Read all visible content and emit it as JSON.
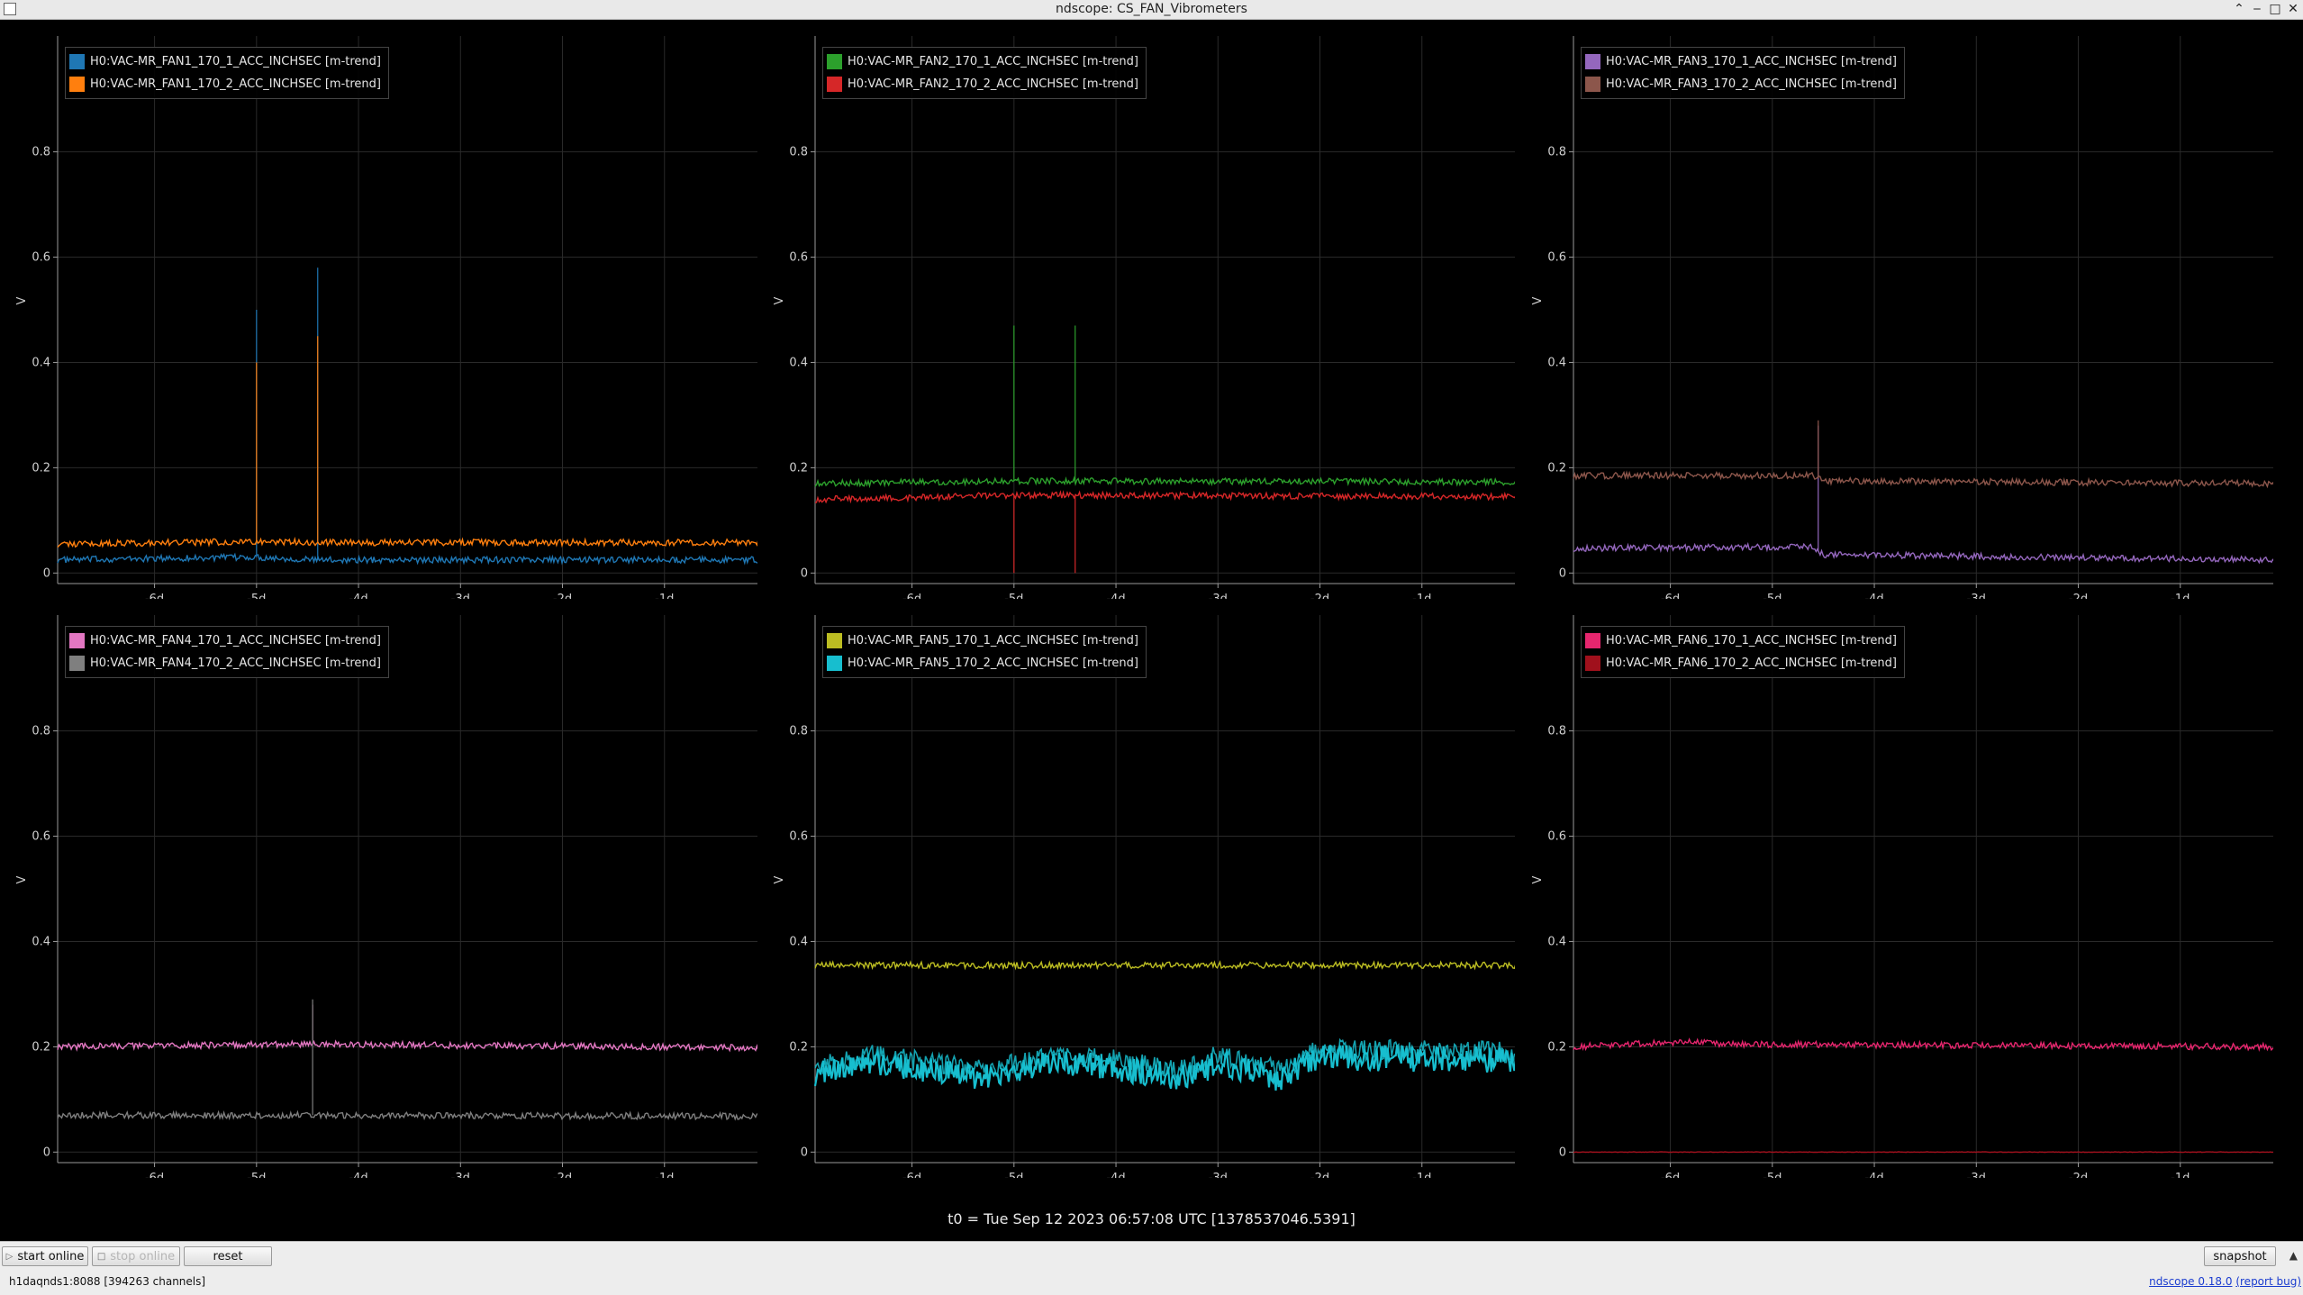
{
  "window": {
    "title": "ndscope: CS_FAN_Vibrometers",
    "controls": [
      "⌃",
      "‒",
      "□",
      "✕"
    ]
  },
  "plots": [
    {
      "legend": [
        {
          "label": "H0:VAC-MR_FAN1_170_1_ACC_INCHSEC [m-trend]",
          "color": "#1f77b4"
        },
        {
          "label": "H0:VAC-MR_FAN1_170_2_ACC_INCHSEC [m-trend]",
          "color": "#ff7f0e"
        }
      ]
    },
    {
      "legend": [
        {
          "label": "H0:VAC-MR_FAN2_170_1_ACC_INCHSEC [m-trend]",
          "color": "#2ca02c"
        },
        {
          "label": "H0:VAC-MR_FAN2_170_2_ACC_INCHSEC [m-trend]",
          "color": "#d62728"
        }
      ]
    },
    {
      "legend": [
        {
          "label": "H0:VAC-MR_FAN3_170_1_ACC_INCHSEC [m-trend]",
          "color": "#9467bd"
        },
        {
          "label": "H0:VAC-MR_FAN3_170_2_ACC_INCHSEC [m-trend]",
          "color": "#8c564b"
        }
      ]
    },
    {
      "legend": [
        {
          "label": "H0:VAC-MR_FAN4_170_1_ACC_INCHSEC [m-trend]",
          "color": "#e377c2"
        },
        {
          "label": "H0:VAC-MR_FAN4_170_2_ACC_INCHSEC [m-trend]",
          "color": "#7f7f7f"
        }
      ]
    },
    {
      "legend": [
        {
          "label": "H0:VAC-MR_FAN5_170_1_ACC_INCHSEC [m-trend]",
          "color": "#bcbd22"
        },
        {
          "label": "H0:VAC-MR_FAN5_170_2_ACC_INCHSEC [m-trend]",
          "color": "#17becf"
        }
      ]
    },
    {
      "legend": [
        {
          "label": "H0:VAC-MR_FAN6_170_1_ACC_INCHSEC [m-trend]",
          "color": "#e6266e"
        },
        {
          "label": "H0:VAC-MR_FAN6_170_2_ACC_INCHSEC [m-trend]",
          "color": "#a0101c"
        }
      ]
    }
  ],
  "axes": {
    "ylabel": "V",
    "xticks": [
      "-6d",
      "-5d",
      "-4d",
      "-3d",
      "-2d",
      "-1d"
    ],
    "yticks": [
      "0",
      "0.2",
      "0.4",
      "0.6",
      "0.8"
    ]
  },
  "chart_data": [
    {
      "type": "line",
      "x_unit": "days",
      "xlim": [
        -6.95,
        0
      ],
      "ylim": [
        0,
        1.0
      ],
      "ylabel": "V",
      "series": [
        {
          "name": "H0:VAC-MR_FAN1_170_1_ACC_INCHSEC [m-trend]",
          "color": "#1f77b4",
          "x": [
            -6.95,
            -5.0,
            -4.4,
            0
          ],
          "y": [
            0.025,
            0.03,
            0.025,
            0.025
          ],
          "spikes": [
            {
              "x": -5.0,
              "y": 0.5
            },
            {
              "x": -4.4,
              "y": 0.58
            }
          ]
        },
        {
          "name": "H0:VAC-MR_FAN1_170_2_ACC_INCHSEC [m-trend]",
          "color": "#ff7f0e",
          "x": [
            -6.95,
            -5.0,
            -4.4,
            0
          ],
          "y": [
            0.055,
            0.06,
            0.058,
            0.058
          ],
          "spikes": [
            {
              "x": -5.0,
              "y": 0.4
            },
            {
              "x": -4.4,
              "y": 0.45
            }
          ]
        }
      ]
    },
    {
      "type": "line",
      "x_unit": "days",
      "xlim": [
        -6.95,
        0
      ],
      "ylim": [
        0,
        1.0
      ],
      "ylabel": "V",
      "series": [
        {
          "name": "H0:VAC-MR_FAN2_170_1_ACC_INCHSEC [m-trend]",
          "color": "#2ca02c",
          "x": [
            -6.95,
            -5.0,
            0
          ],
          "y": [
            0.17,
            0.175,
            0.173
          ],
          "spikes": [
            {
              "x": -5.0,
              "y": 0.47
            },
            {
              "x": -4.4,
              "y": 0.47
            }
          ]
        },
        {
          "name": "H0:VAC-MR_FAN2_170_2_ACC_INCHSEC [m-trend]",
          "color": "#d62728",
          "x": [
            -6.95,
            -5.0,
            0
          ],
          "y": [
            0.14,
            0.148,
            0.145
          ],
          "spikes": [
            {
              "x": -5.0,
              "y": 0.0
            },
            {
              "x": -4.4,
              "y": 0.0
            }
          ]
        }
      ]
    },
    {
      "type": "line",
      "x_unit": "days",
      "xlim": [
        -6.95,
        0
      ],
      "ylim": [
        0,
        1.0
      ],
      "ylabel": "V",
      "series": [
        {
          "name": "H0:VAC-MR_FAN3_170_1_ACC_INCHSEC [m-trend]",
          "color": "#9467bd",
          "x": [
            -6.95,
            -4.6,
            -4.5,
            0
          ],
          "y": [
            0.047,
            0.05,
            0.035,
            0.025
          ],
          "spikes": [
            {
              "x": -4.55,
              "y": 0.28
            }
          ]
        },
        {
          "name": "H0:VAC-MR_FAN3_170_2_ACC_INCHSEC [m-trend]",
          "color": "#8c564b",
          "x": [
            -6.95,
            -4.6,
            -4.5,
            0
          ],
          "y": [
            0.185,
            0.185,
            0.175,
            0.17
          ],
          "spikes": [
            {
              "x": -4.55,
              "y": 0.29
            }
          ]
        }
      ]
    },
    {
      "type": "line",
      "x_unit": "days",
      "xlim": [
        -6.95,
        0
      ],
      "ylim": [
        0,
        1.0
      ],
      "ylabel": "V",
      "series": [
        {
          "name": "H0:VAC-MR_FAN4_170_1_ACC_INCHSEC [m-trend]",
          "color": "#e377c2",
          "x": [
            -6.95,
            -4.5,
            0
          ],
          "y": [
            0.2,
            0.205,
            0.198
          ],
          "spikes": [
            {
              "x": -4.45,
              "y": 0.28
            }
          ]
        },
        {
          "name": "H0:VAC-MR_FAN4_170_2_ACC_INCHSEC [m-trend]",
          "color": "#7f7f7f",
          "x": [
            -6.95,
            -4.5,
            0
          ],
          "y": [
            0.07,
            0.07,
            0.068
          ],
          "spikes": [
            {
              "x": -4.45,
              "y": 0.29
            }
          ]
        }
      ]
    },
    {
      "type": "line",
      "x_unit": "days",
      "xlim": [
        -6.95,
        0
      ],
      "ylim": [
        0,
        1.0
      ],
      "ylabel": "V",
      "series": [
        {
          "name": "H0:VAC-MR_FAN5_170_1_ACC_INCHSEC [m-trend]",
          "color": "#bcbd22",
          "x": [
            -6.95,
            0
          ],
          "y": [
            0.355,
            0.355
          ]
        },
        {
          "name": "H0:VAC-MR_FAN5_170_2_ACC_INCHSEC [m-trend]",
          "color": "#17becf",
          "x": [
            -6.95,
            -6.4,
            -5.3,
            -4.6,
            -4.0,
            -3.3,
            -3.0,
            -2.4,
            -2.0,
            0
          ],
          "y": [
            0.15,
            0.17,
            0.14,
            0.17,
            0.16,
            0.14,
            0.17,
            0.14,
            0.18,
            0.175
          ]
        }
      ]
    },
    {
      "type": "line",
      "x_unit": "days",
      "xlim": [
        -6.95,
        0
      ],
      "ylim": [
        0,
        1.0
      ],
      "ylabel": "V",
      "series": [
        {
          "name": "H0:VAC-MR_FAN6_170_1_ACC_INCHSEC [m-trend]",
          "color": "#e6266e",
          "x": [
            -6.95,
            -5.8,
            -5.5,
            0
          ],
          "y": [
            0.2,
            0.21,
            0.205,
            0.2
          ]
        },
        {
          "name": "H0:VAC-MR_FAN6_170_2_ACC_INCHSEC [m-trend]",
          "color": "#a0101c",
          "x": [
            -6.95,
            0
          ],
          "y": [
            0.0,
            0.0
          ]
        }
      ]
    }
  ],
  "t0_label": "t0 = Tue Sep 12 2023 06:57:08 UTC [1378537046.5391]",
  "buttons": {
    "start_online": "start online",
    "stop_online": "stop online",
    "reset": "reset",
    "snapshot": "snapshot"
  },
  "status": "h1daqnds1:8088  [394263 channels]",
  "version": {
    "name": "ndscope 0.18.0",
    "report": "(report bug)"
  }
}
